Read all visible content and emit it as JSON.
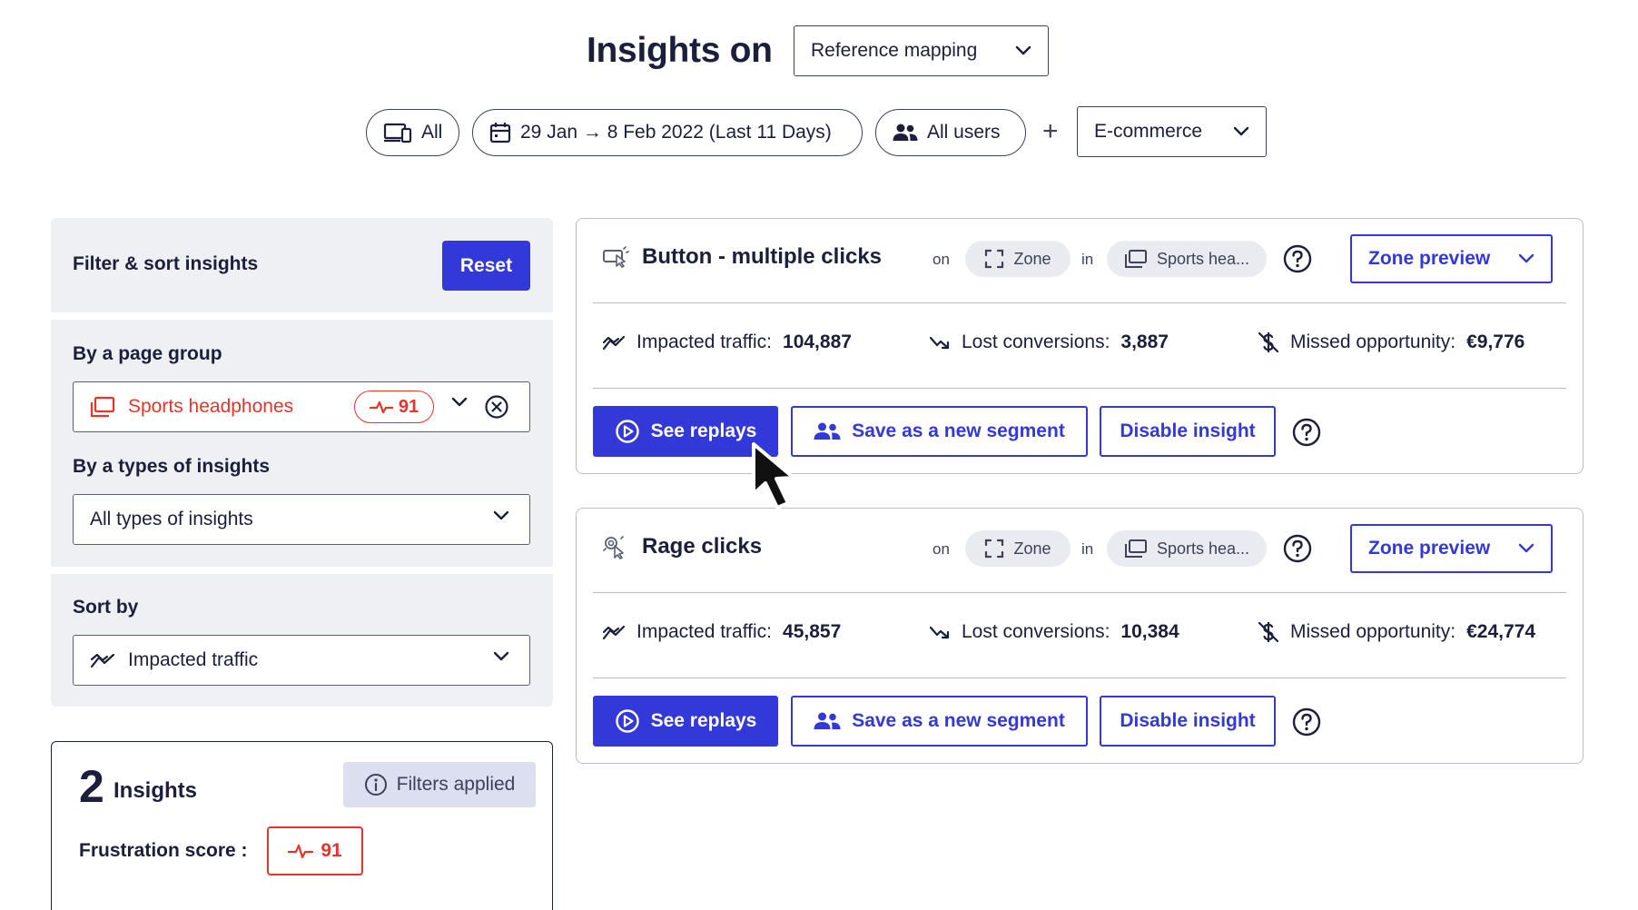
{
  "header": {
    "title": "Insights on",
    "mapping_select": "Reference mapping"
  },
  "filters": {
    "device": "All",
    "date_range": "29 Jan → 8 Feb 2022 (Last 11 Days)",
    "users": "All users",
    "plus": "+",
    "segment_select": "E-commerce"
  },
  "sidebar": {
    "title": "Filter & sort insights",
    "reset_label": "Reset",
    "page_group": {
      "label": "By a page group",
      "value": "Sports headphones",
      "score": "91"
    },
    "insight_types": {
      "label": "By a types of insights",
      "value": "All types of insights"
    },
    "sort": {
      "label": "Sort by",
      "value": "Impacted traffic"
    }
  },
  "summary": {
    "count": "2",
    "count_label": "Insights",
    "filters_applied": "Filters applied",
    "frustration_label": "Frustration score :",
    "frustration_score": "91"
  },
  "insights": [
    {
      "title": "Button - multiple clicks",
      "on_label": "on",
      "zone_chip": "Zone",
      "in_label": "in",
      "page_chip": "Sports hea...",
      "zone_preview": "Zone preview",
      "impacted_label": "Impacted traffic:",
      "impacted_value": "104,887",
      "lost_label": "Lost conversions:",
      "lost_value": "3,887",
      "missed_label": "Missed opportunity:",
      "missed_value": "€9,776",
      "see_replays": "See replays",
      "save_segment": "Save as a new segment",
      "disable": "Disable insight"
    },
    {
      "title": "Rage clicks",
      "on_label": "on",
      "zone_chip": "Zone",
      "in_label": "in",
      "page_chip": "Sports hea...",
      "zone_preview": "Zone preview",
      "impacted_label": "Impacted traffic:",
      "impacted_value": "45,857",
      "lost_label": "Lost conversions:",
      "lost_value": "10,384",
      "missed_label": "Missed opportunity:",
      "missed_value": "€24,774",
      "see_replays": "See replays",
      "save_segment": "Save as a new segment",
      "disable": "Disable insight"
    }
  ],
  "colors": {
    "primary": "#3339d8",
    "text": "#1b1f3b",
    "danger": "#e2352b",
    "panel_bg": "#eef0f4"
  },
  "icons": {
    "device": "devices-icon",
    "calendar": "calendar-icon",
    "users": "users-icon",
    "chevron": "chevron-down-icon",
    "page": "page-group-icon",
    "pulse": "pulse-icon",
    "clear": "clear-icon",
    "traffic": "trend-up-icon",
    "lost": "trend-down-icon",
    "missed": "no-dollar-icon",
    "play": "play-icon",
    "help": "help-icon",
    "info": "info-icon",
    "zone": "zone-icon",
    "cursor": "mouse-pointer-icon"
  }
}
